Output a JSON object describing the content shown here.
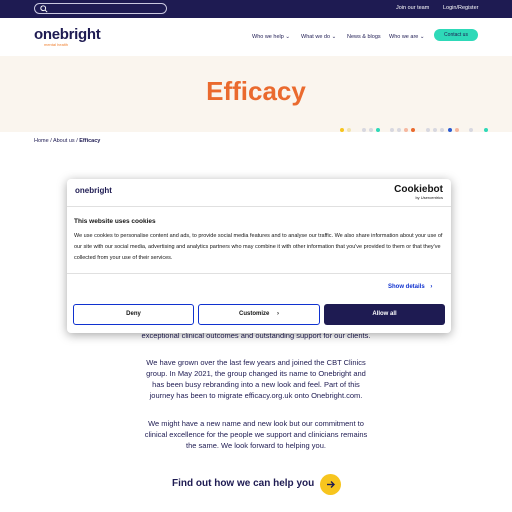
{
  "topbar": {
    "search_placeholder": "",
    "links": [
      "Join our team",
      "Login/Register"
    ]
  },
  "header": {
    "logo_text": "onebright",
    "logo_tagline": "mental health",
    "nav": [
      "Who we help",
      "What we do",
      "News & blogs",
      "Who we are"
    ],
    "contact_label": "Contact us"
  },
  "hero": {
    "title": "Efficacy"
  },
  "breadcrumb": {
    "home": "Home",
    "sep1": " / ",
    "about": "About us",
    "sep2": " / ",
    "current": "Efficacy"
  },
  "body": {
    "para1": "exceptional clinical outcomes and outstanding support for our clients.",
    "para2": "We have grown over the last few years and joined the CBT Clinics group. In May 2021, the group changed its name to Onebright and has been busy rebranding into a new look and feel. Part of this journey has been to migrate efficacy.org.uk onto Onebright.com.",
    "para3": "We might have a new name and new look but our commitment to clinical excellence for the people we support and clinicians remains the same. We look forward to helping you.",
    "cta": "Find out how we can help you"
  },
  "cookie": {
    "logo_text": "onebright",
    "brand_name": "Cookiebot",
    "brand_by": "by Usercentrics",
    "title": "This website uses cookies",
    "text": "We use cookies to personalise content and ads, to provide social media features and to analyse our traffic. We also share information about your use of our site with our social media, advertising and analytics partners who may combine it with other information that you've provided to them or that they've collected from your use of their services.",
    "details_label": "Show details",
    "deny_label": "Deny",
    "customize_label": "Customize",
    "allow_label": "Allow all"
  },
  "colors": {
    "navy": "#1e1b52",
    "orange": "#ea6a2e",
    "teal": "#2ed9b8",
    "yellow": "#f7c51e",
    "cookie_blue": "#1032cf"
  }
}
